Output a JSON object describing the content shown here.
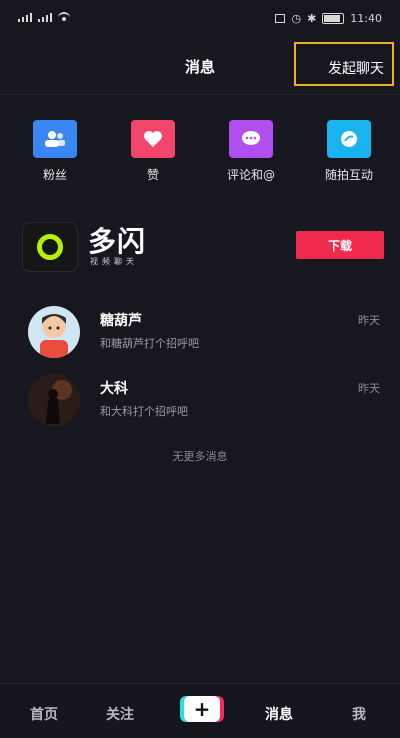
{
  "status_bar": {
    "time": "11:40"
  },
  "header": {
    "title": "消息",
    "start_chat": "发起聊天"
  },
  "quick_actions": [
    {
      "label": "粉丝",
      "icon": "fans-icon",
      "color": "#3a86f5"
    },
    {
      "label": "赞",
      "icon": "heart-icon",
      "color": "#f2476b"
    },
    {
      "label": "评论和@",
      "icon": "comment-icon",
      "color": "#b04ef0"
    },
    {
      "label": "随拍互动",
      "icon": "snap-icon",
      "color": "#19b4f0"
    }
  ],
  "banner": {
    "app_name": "多闪",
    "app_subtitle": "视频聊天",
    "download_label": "下载"
  },
  "chats": [
    {
      "name": "糖葫芦",
      "preview": "和糖葫芦打个招呼吧",
      "time": "昨天"
    },
    {
      "name": "大科",
      "preview": "和大科打个招呼吧",
      "time": "昨天"
    }
  ],
  "no_more": "无更多消息",
  "bottom_nav": {
    "home": "首页",
    "follow": "关注",
    "plus": "+",
    "messages": "消息",
    "me": "我"
  }
}
